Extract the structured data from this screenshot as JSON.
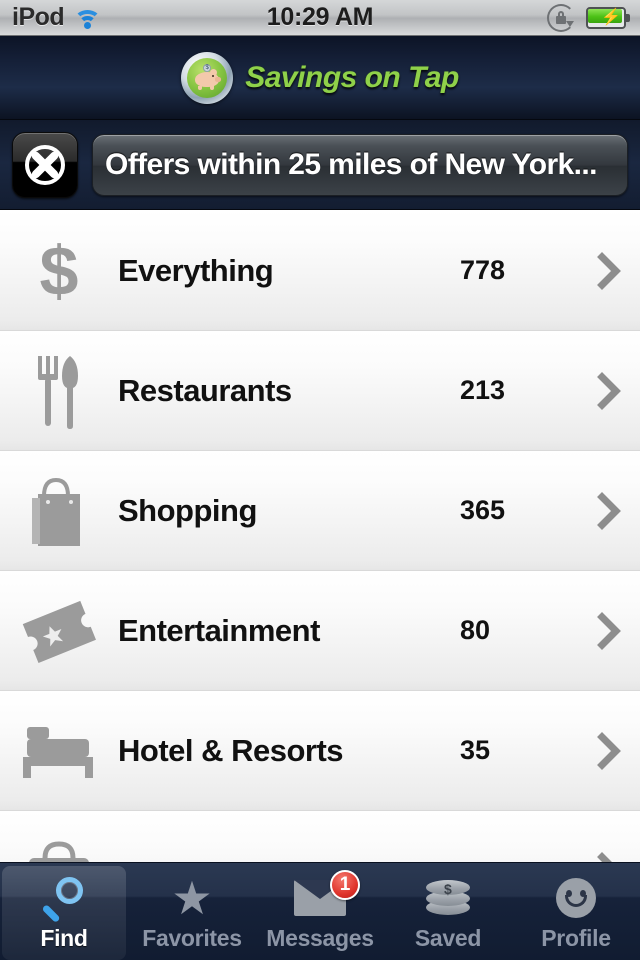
{
  "status_bar": {
    "carrier": "iPod",
    "wifi_icon": "wifi-icon",
    "time": "10:29 AM",
    "rotation_lock_icon": "rotation-lock-icon",
    "battery_icon": "battery-charging-icon"
  },
  "header": {
    "logo_icon": "piggy-bank-logo",
    "app_title": "Savings on Tap",
    "title_color": "#8fd14a"
  },
  "filter_bar": {
    "left_button_icon": "clover-x-icon",
    "filter_text": "Offers within 25 miles of New York..."
  },
  "list": {
    "rows": [
      {
        "icon": "dollar-sign-icon",
        "label": "Everything",
        "count": "778",
        "chevron": "chevron-right-icon"
      },
      {
        "icon": "fork-knife-icon",
        "label": "Restaurants",
        "count": "213",
        "chevron": "chevron-right-icon"
      },
      {
        "icon": "shopping-bag-icon",
        "label": "Shopping",
        "count": "365",
        "chevron": "chevron-right-icon"
      },
      {
        "icon": "ticket-icon",
        "label": "Entertainment",
        "count": "80",
        "chevron": "chevron-right-icon"
      },
      {
        "icon": "bed-icon",
        "label": "Hotel & Resorts",
        "count": "35",
        "chevron": "chevron-right-icon"
      },
      {
        "icon": "briefcase-icon",
        "label": "",
        "count": "",
        "chevron": "chevron-right-icon"
      }
    ]
  },
  "tab_bar": {
    "tabs": [
      {
        "icon": "magnifier-icon",
        "label": "Find",
        "active": true,
        "badge": ""
      },
      {
        "icon": "star-icon",
        "label": "Favorites",
        "active": false,
        "badge": ""
      },
      {
        "icon": "envelope-icon",
        "label": "Messages",
        "active": false,
        "badge": "1"
      },
      {
        "icon": "coins-icon",
        "label": "Saved",
        "active": false,
        "badge": ""
      },
      {
        "icon": "smiley-icon",
        "label": "Profile",
        "active": false,
        "badge": ""
      }
    ],
    "badge_color": "#e0352c"
  }
}
